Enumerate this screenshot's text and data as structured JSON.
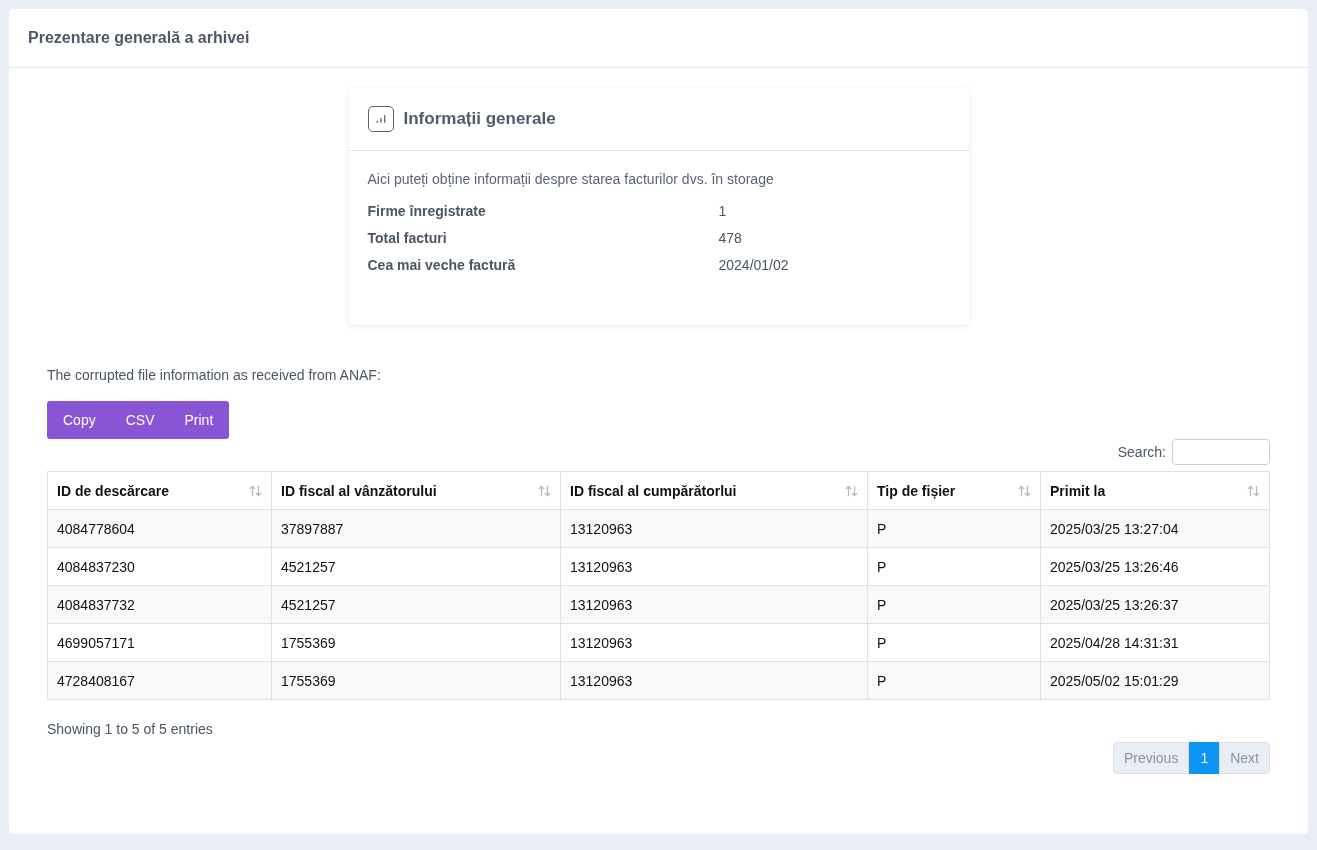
{
  "panel": {
    "title": "Prezentare generală a arhivei"
  },
  "info_card": {
    "title": "Informații generale",
    "description": "Aici puteți obține informații despre starea facturilor dvs. în storage",
    "rows": [
      {
        "label": "Firme înregistrate",
        "value": "1"
      },
      {
        "label": "Total facturi",
        "value": "478"
      },
      {
        "label": "Cea mai veche factură",
        "value": "2024/01/02"
      }
    ]
  },
  "table_intro": "The corrupted file information as received from ANAF:",
  "export_buttons": [
    "Copy",
    "CSV",
    "Print"
  ],
  "search": {
    "label": "Search:"
  },
  "table": {
    "columns": [
      "ID de descărcare",
      "ID fiscal al vânzătorului",
      "ID fiscal al cumpărătorlui",
      "Tip de fișier",
      "Primit la"
    ],
    "rows": [
      [
        "4084778604",
        "37897887",
        "13120963",
        "P",
        "2025/03/25 13:27:04"
      ],
      [
        "4084837230",
        "4521257",
        "13120963",
        "P",
        "2025/03/25 13:26:46"
      ],
      [
        "4084837732",
        "4521257",
        "13120963",
        "P",
        "2025/03/25 13:26:37"
      ],
      [
        "4699057171",
        "1755369",
        "13120963",
        "P",
        "2025/04/28 14:31:31"
      ],
      [
        "4728408167",
        "1755369",
        "13120963",
        "P",
        "2025/05/02 15:01:29"
      ]
    ]
  },
  "table_info": "Showing 1 to 5 of 5 entries",
  "pagination": [
    {
      "label": "Previous",
      "selected": false,
      "disabled": true
    },
    {
      "label": "1",
      "selected": true,
      "disabled": false
    },
    {
      "label": "Next",
      "selected": false,
      "disabled": true
    }
  ]
}
